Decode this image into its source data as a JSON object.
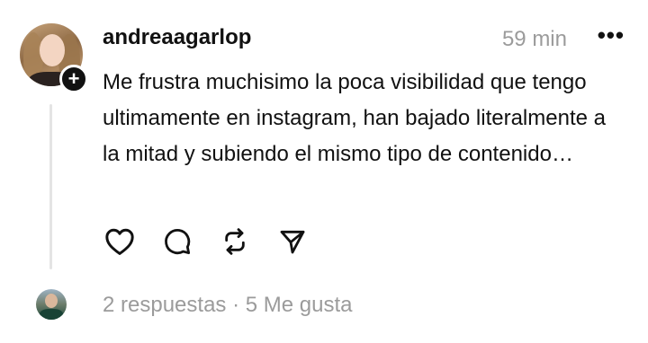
{
  "post": {
    "username": "andreaagarlop",
    "time": "59 min",
    "more_glyph": "•••",
    "text": "Me frustra muchisimo la poca visibilidad que tengo ultimamente en instagram, han bajado literalmente a la mitad y subiendo el mismo tipo de contenido…",
    "add_glyph": "+"
  },
  "actions": [
    "heart-icon",
    "comment-icon",
    "repost-icon",
    "share-icon"
  ],
  "footer": {
    "replies": "2 respuestas",
    "separator": " · ",
    "likes": "5 Me gusta"
  }
}
